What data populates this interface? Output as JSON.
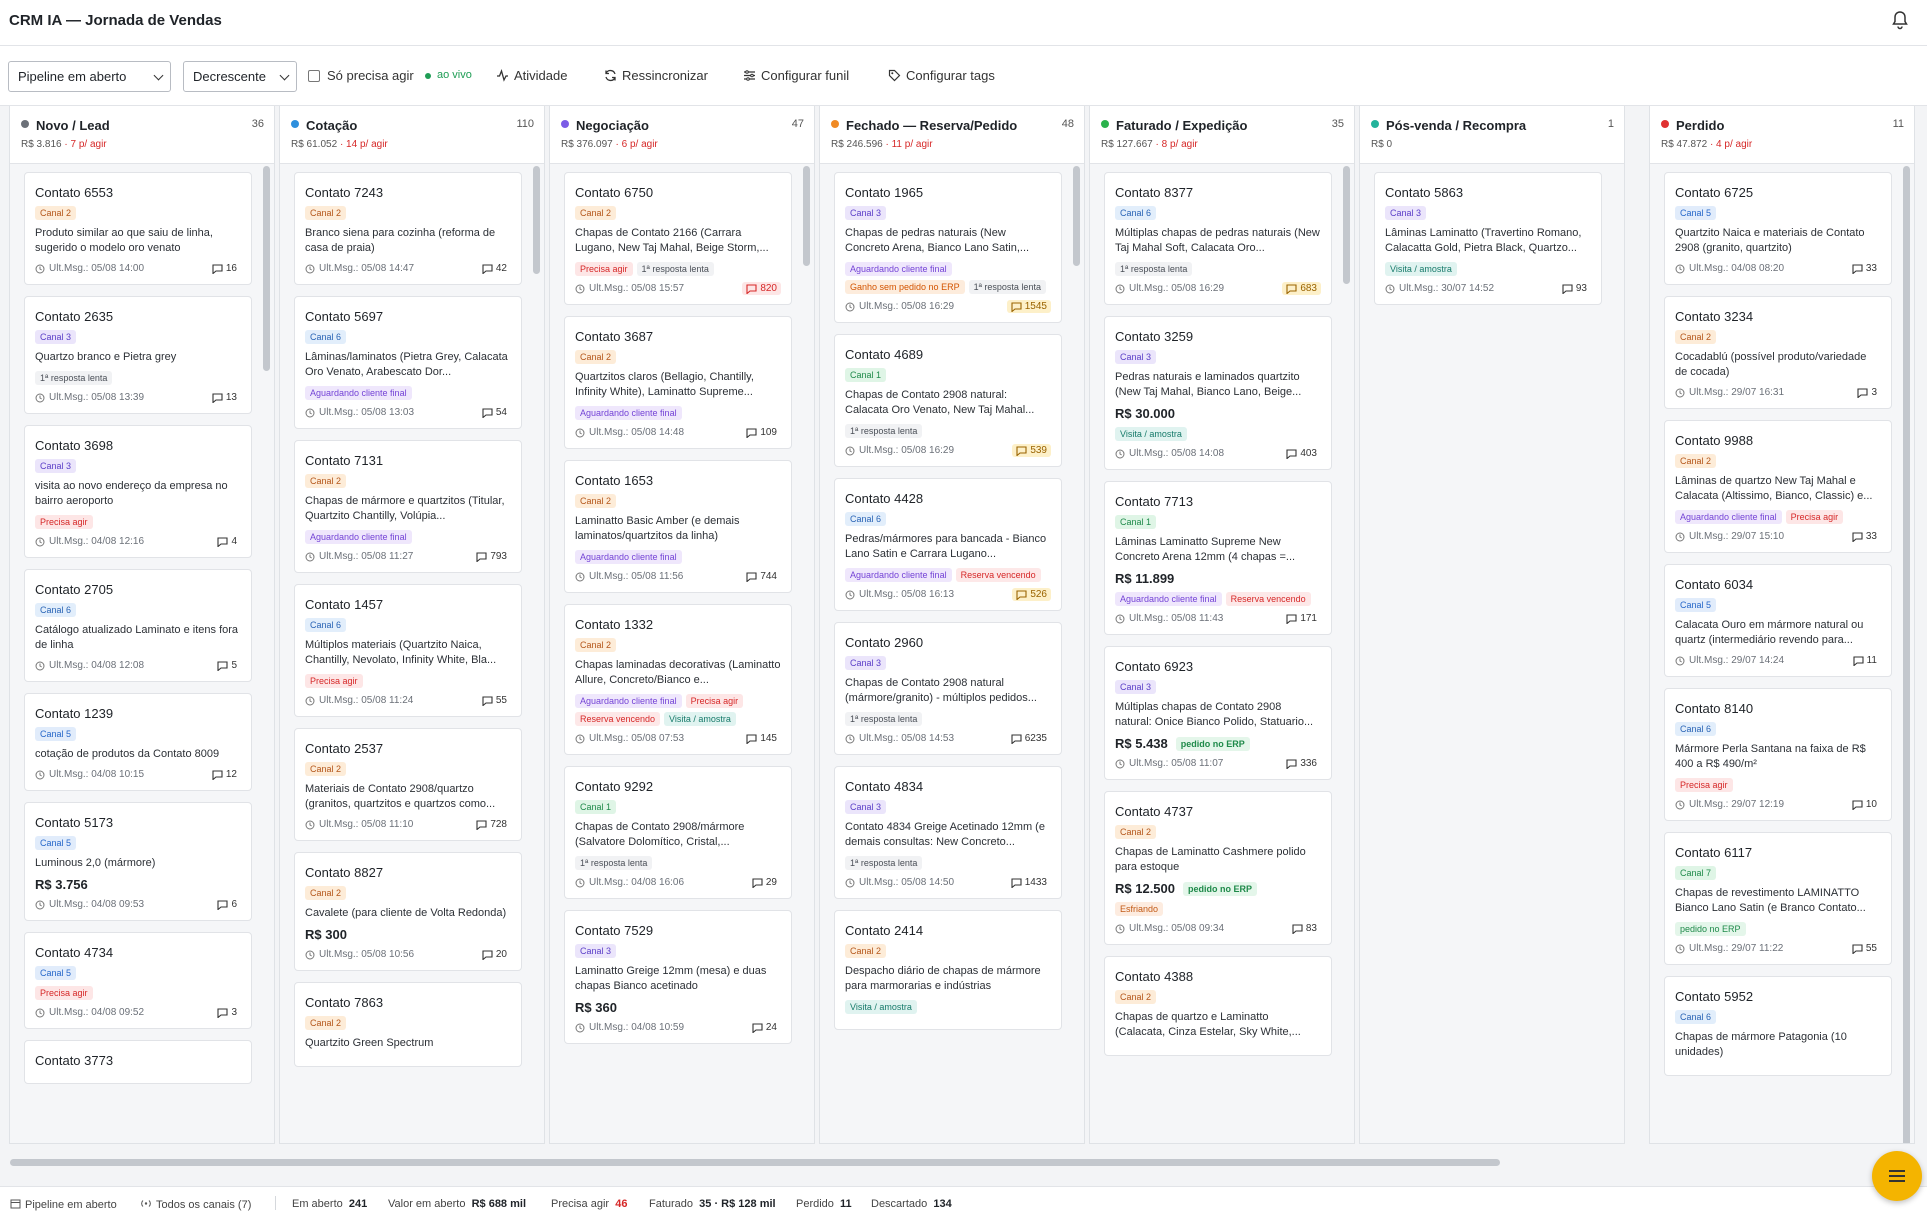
{
  "header": {
    "title": "CRM IA — Jornada de Vendas"
  },
  "toolbar": {
    "pipeline_select": "Pipeline em aberto",
    "order_select": "Decrescente",
    "only_action_label": "Só precisa agir",
    "live_label": "ao vivo",
    "activity_label": "Atividade",
    "resync_label": "Ressincronizar",
    "funnel_label": "Configurar funil",
    "tags_label": "Configurar tags"
  },
  "columns": [
    {
      "title": "Novo / Lead",
      "count": "36",
      "total": "R$ 3.816",
      "act": "· 7 p/ agir",
      "color": "#6b7078",
      "cards": [
        {
          "name": "Contato 6553",
          "tags": [
            [
              "Canal 2",
              "canal"
            ]
          ],
          "desc": "Produto similar ao que saiu de linha, sugerido o modelo oro venato",
          "time": "Ult.Msg.: 05/08 14:00",
          "msgs": "16"
        },
        {
          "name": "Contato 2635",
          "tags": [
            [
              "Canal 3",
              "c3"
            ]
          ],
          "desc": "Quartzo branco e Pietra grey",
          "tags2": [
            [
              "1ª resposta lenta",
              "lenta"
            ]
          ],
          "time": "Ult.Msg.: 05/08 13:39",
          "msgs": "13"
        },
        {
          "name": "Contato 3698",
          "tags": [
            [
              "Canal 3",
              "c3"
            ]
          ],
          "desc": "visita ao novo endereço da empresa no bairro aeroporto",
          "tags2": [
            [
              "Precisa agir",
              "agir"
            ]
          ],
          "time": "Ult.Msg.: 04/08 12:16",
          "msgs": "4"
        },
        {
          "name": "Contato 2705",
          "tags": [
            [
              "Canal 6",
              "c6"
            ]
          ],
          "desc": "Catálogo atualizado Laminato e itens fora de linha",
          "time": "Ult.Msg.: 04/08 12:08",
          "msgs": "5"
        },
        {
          "name": "Contato 1239",
          "tags": [
            [
              "Canal 5",
              "c5"
            ]
          ],
          "desc": "cotação de produtos da Contato 8009",
          "time": "Ult.Msg.: 04/08 10:15",
          "msgs": "12"
        },
        {
          "name": "Contato 5173",
          "tags": [
            [
              "Canal 5",
              "c5"
            ]
          ],
          "desc": "Luminous 2,0 (mármore)",
          "value": "R$ 3.756",
          "time": "Ult.Msg.: 04/08 09:53",
          "msgs": "6"
        },
        {
          "name": "Contato 4734",
          "tags": [
            [
              "Canal 5",
              "c5"
            ]
          ],
          "tags2": [
            [
              "Precisa agir",
              "agir"
            ]
          ],
          "time": "Ult.Msg.: 04/08 09:52",
          "msgs": "3"
        },
        {
          "name": "Contato 3773",
          "tags": [],
          "time": "",
          "msgs": ""
        }
      ]
    },
    {
      "title": "Cotação",
      "count": "110",
      "total": "R$ 61.052",
      "act": "· 14 p/ agir",
      "color": "#2d8fdd",
      "cards": [
        {
          "name": "Contato 7243",
          "tags": [
            [
              "Canal 2",
              "canal"
            ]
          ],
          "desc": "Branco siena para cozinha (reforma de casa de praia)",
          "time": "Ult.Msg.: 05/08 14:47",
          "msgs": "42"
        },
        {
          "name": "Contato 5697",
          "tags": [
            [
              "Canal 6",
              "c6"
            ]
          ],
          "desc": "Lâminas/laminatos (Pietra Grey, Calacata Oro Venato, Arabescato Dor...",
          "tags2": [
            [
              "Aguardando cliente final",
              "aguard"
            ]
          ],
          "time": "Ult.Msg.: 05/08 13:03",
          "msgs": "54"
        },
        {
          "name": "Contato 7131",
          "tags": [
            [
              "Canal 2",
              "canal"
            ]
          ],
          "desc": "Chapas de mármore e quartzitos (Titular, Quartzito Chantilly, Volúpia...",
          "tags2": [
            [
              "Aguardando cliente final",
              "aguard"
            ]
          ],
          "time": "Ult.Msg.: 05/08 11:27",
          "msgs": "793"
        },
        {
          "name": "Contato 1457",
          "tags": [
            [
              "Canal 6",
              "c6"
            ]
          ],
          "desc": "Múltiplos materiais (Quartzito Naica, Chantilly, Nevolato, Infinity White, Bla...",
          "tags2": [
            [
              "Precisa agir",
              "agir"
            ]
          ],
          "time": "Ult.Msg.: 05/08 11:24",
          "msgs": "55"
        },
        {
          "name": "Contato 2537",
          "tags": [
            [
              "Canal 2",
              "canal"
            ]
          ],
          "desc": "Materiais de Contato 2908/quartzo (granitos, quartzitos e quartzos como...",
          "time": "Ult.Msg.: 05/08 11:10",
          "msgs": "728"
        },
        {
          "name": "Contato 8827",
          "tags": [
            [
              "Canal 2",
              "canal"
            ]
          ],
          "desc": "Cavalete (para cliente de Volta Redonda)",
          "value": "R$ 300",
          "time": "Ult.Msg.: 05/08 10:56",
          "msgs": "20"
        },
        {
          "name": "Contato 7863",
          "tags": [
            [
              "Canal 2",
              "canal"
            ]
          ],
          "desc": "Quartzito Green Spectrum",
          "time": "",
          "msgs": ""
        }
      ]
    },
    {
      "title": "Negociação",
      "count": "47",
      "total": "R$ 376.097",
      "act": "· 6 p/ agir",
      "color": "#7b5ce6",
      "cards": [
        {
          "name": "Contato 6750",
          "tags": [
            [
              "Canal 2",
              "canal"
            ]
          ],
          "desc": "Chapas de Contato 2166 (Carrara Lugano, New Taj Mahal, Beige Storm,...",
          "tags2": [
            [
              "Precisa agir",
              "agir"
            ],
            [
              "1ª resposta lenta",
              "lenta"
            ]
          ],
          "time": "Ult.Msg.: 05/08 15:57",
          "msgs": "820",
          "hot": "hot"
        },
        {
          "name": "Contato 3687",
          "tags": [
            [
              "Canal 2",
              "canal"
            ]
          ],
          "desc": "Quartzitos claros (Bellagio, Chantilly, Infinity White), Laminatto Supreme...",
          "tags2": [
            [
              "Aguardando cliente final",
              "aguard"
            ]
          ],
          "time": "Ult.Msg.: 05/08 14:48",
          "msgs": "109"
        },
        {
          "name": "Contato 1653",
          "tags": [
            [
              "Canal 2",
              "canal"
            ]
          ],
          "desc": "Laminatto Basic Amber (e demais laminatos/quartzitos da linha)",
          "tags2": [
            [
              "Aguardando cliente final",
              "aguard"
            ]
          ],
          "time": "Ult.Msg.: 05/08 11:56",
          "msgs": "744"
        },
        {
          "name": "Contato 1332",
          "tags": [
            [
              "Canal 2",
              "canal"
            ]
          ],
          "desc": "Chapas laminadas decorativas (Laminatto Allure, Concreto/Bianco e...",
          "tags2": [
            [
              "Aguardando cliente final",
              "aguard"
            ],
            [
              "Precisa agir",
              "agir"
            ],
            [
              "Reserva vencendo",
              "reserva"
            ],
            [
              "Visita / amostra",
              "visita"
            ]
          ],
          "time": "Ult.Msg.: 05/08 07:53",
          "msgs": "145"
        },
        {
          "name": "Contato 9292",
          "tags": [
            [
              "Canal 1",
              "c1"
            ]
          ],
          "desc": "Chapas de Contato 2908/mármore (Salvatore Dolomítico, Cristal,...",
          "tags2": [
            [
              "1ª resposta lenta",
              "lenta"
            ]
          ],
          "time": "Ult.Msg.: 04/08 16:06",
          "msgs": "29"
        },
        {
          "name": "Contato 7529",
          "tags": [
            [
              "Canal 3",
              "c3"
            ]
          ],
          "desc": "Laminatto Greige 12mm (mesa) e duas chapas Bianco acetinado",
          "value": "R$ 360",
          "time": "Ult.Msg.: 04/08 10:59",
          "msgs": "24"
        }
      ]
    },
    {
      "title": "Fechado — Reserva/Pedido",
      "count": "48",
      "total": "R$ 246.596",
      "act": "· 11 p/ agir",
      "color": "#f08a24",
      "cards": [
        {
          "name": "Contato 1965",
          "tags": [
            [
              "Canal 3",
              "c3"
            ]
          ],
          "desc": "Chapas de pedras naturais (New Concreto Arena, Bianco Lano Satin,...",
          "tags2": [
            [
              "Aguardando cliente final",
              "aguard"
            ],
            [
              "Ganho sem pedido no ERP",
              "ganho"
            ],
            [
              "1ª resposta lenta",
              "lenta"
            ]
          ],
          "time": "Ult.Msg.: 05/08 16:29",
          "msgs": "1545",
          "hot": "warm"
        },
        {
          "name": "Contato 4689",
          "tags": [
            [
              "Canal 1",
              "c1"
            ]
          ],
          "desc": "Chapas de Contato 2908 natural: Calacata Oro Venato, New Taj Mahal...",
          "tags2": [
            [
              "1ª resposta lenta",
              "lenta"
            ]
          ],
          "time": "Ult.Msg.: 05/08 16:29",
          "msgs": "539",
          "hot": "warm"
        },
        {
          "name": "Contato 4428",
          "tags": [
            [
              "Canal 6",
              "c6"
            ]
          ],
          "desc": "Pedras/mármores para bancada - Bianco Lano Satin e Carrara Lugano...",
          "tags2": [
            [
              "Aguardando cliente final",
              "aguard"
            ],
            [
              "Reserva vencendo",
              "reserva"
            ]
          ],
          "time": "Ult.Msg.: 05/08 16:13",
          "msgs": "526",
          "hot": "warm"
        },
        {
          "name": "Contato 2960",
          "tags": [
            [
              "Canal 3",
              "c3"
            ]
          ],
          "desc": "Chapas de Contato 2908 natural (mármore/granito) - múltiplos pedidos...",
          "tags2": [
            [
              "1ª resposta lenta",
              "lenta"
            ]
          ],
          "time": "Ult.Msg.: 05/08 14:53",
          "msgs": "6235"
        },
        {
          "name": "Contato 4834",
          "tags": [
            [
              "Canal 3",
              "c3"
            ]
          ],
          "desc": "Contato 4834 Greige Acetinado 12mm (e demais consultas: New Concreto...",
          "tags2": [
            [
              "1ª resposta lenta",
              "lenta"
            ]
          ],
          "time": "Ult.Msg.: 05/08 14:50",
          "msgs": "1433"
        },
        {
          "name": "Contato 2414",
          "tags": [
            [
              "Canal 2",
              "canal"
            ]
          ],
          "desc": "Despacho diário de chapas de mármore para marmorarias e indústrias",
          "tags2": [
            [
              "Visita / amostra",
              "visita"
            ]
          ],
          "time": "",
          "msgs": ""
        }
      ]
    },
    {
      "title": "Faturado / Expedição",
      "count": "35",
      "total": "R$ 127.667",
      "act": "· 8 p/ agir",
      "color": "#2bb24c",
      "cards": [
        {
          "name": "Contato 8377",
          "tags": [
            [
              "Canal 6",
              "c6"
            ]
          ],
          "desc": "Múltiplas chapas de pedras naturais (New Taj Mahal Soft, Calacata Oro...",
          "tags2": [
            [
              "1ª resposta lenta",
              "lenta"
            ]
          ],
          "time": "Ult.Msg.: 05/08 16:29",
          "msgs": "683",
          "hot": "warm"
        },
        {
          "name": "Contato 3259",
          "tags": [
            [
              "Canal 3",
              "c3"
            ]
          ],
          "desc": "Pedras naturais e laminados quartzito (New Taj Mahal, Bianco Lano, Beige...",
          "value": "R$ 30.000",
          "tags2": [
            [
              "Visita / amostra",
              "visita"
            ]
          ],
          "time": "Ult.Msg.: 05/08 14:08",
          "msgs": "403"
        },
        {
          "name": "Contato 7713",
          "tags": [
            [
              "Canal 1",
              "c1"
            ]
          ],
          "desc": "Lâminas Laminatto Supreme New Concreto Arena 12mm (4 chapas =...",
          "value": "R$ 11.899",
          "tags2": [
            [
              "Aguardando cliente final",
              "aguard"
            ],
            [
              "Reserva vencendo",
              "reserva"
            ]
          ],
          "time": "Ult.Msg.: 05/08 11:43",
          "msgs": "171"
        },
        {
          "name": "Contato 6923",
          "tags": [
            [
              "Canal 3",
              "c3"
            ]
          ],
          "desc": "Múltiplas chapas de Contato 2908 natural: Onice Bianco Polido, Statuario...",
          "value": "R$ 5.438",
          "erp": "pedido no ERP",
          "time": "Ult.Msg.: 05/08 11:07",
          "msgs": "336"
        },
        {
          "name": "Contato 4737",
          "tags": [
            [
              "Canal 2",
              "canal"
            ]
          ],
          "desc": "Chapas de Laminatto Cashmere polido para estoque",
          "value": "R$ 12.500",
          "erp": "pedido no ERP",
          "tags2": [
            [
              "Esfriando",
              "esfr"
            ]
          ],
          "time": "Ult.Msg.: 05/08 09:34",
          "msgs": "83"
        },
        {
          "name": "Contato 4388",
          "tags": [
            [
              "Canal 2",
              "canal"
            ]
          ],
          "desc": "Chapas de quartzo e Laminatto (Calacata, Cinza Estelar, Sky White,...",
          "time": "",
          "msgs": ""
        }
      ]
    },
    {
      "title": "Pós-venda / Recompra",
      "count": "1",
      "total": "R$ 0",
      "act": "",
      "color": "#23b39b",
      "cards": [
        {
          "name": "Contato 5863",
          "tags": [
            [
              "Canal 3",
              "c3"
            ]
          ],
          "desc": "Lâminas Laminatto (Travertino Romano, Calacatta Gold, Pietra Black, Quartzo...",
          "tags2": [
            [
              "Visita / amostra",
              "visita"
            ]
          ],
          "time": "Ult.Msg.: 30/07 14:52",
          "msgs": "93"
        }
      ]
    },
    {
      "title": "Perdido",
      "count": "11",
      "total": "R$ 47.872",
      "act": "· 4 p/ agir",
      "color": "#e03131",
      "cards": [
        {
          "name": "Contato 6725",
          "tags": [
            [
              "Canal 5",
              "c5"
            ]
          ],
          "desc": "Quartzito Naica e materiais de Contato 2908 (granito, quartzito)",
          "time": "Ult.Msg.: 04/08 08:20",
          "msgs": "33"
        },
        {
          "name": "Contato 3234",
          "tags": [
            [
              "Canal 2",
              "canal"
            ]
          ],
          "desc": "Cocadablú (possível produto/variedade de cocada)",
          "time": "Ult.Msg.: 29/07 16:31",
          "msgs": "3"
        },
        {
          "name": "Contato 9988",
          "tags": [
            [
              "Canal 2",
              "canal"
            ]
          ],
          "desc": "Lâminas de quartzo New Taj Mahal e Calacata (Altissimo, Bianco, Classic) e...",
          "tags2": [
            [
              "Aguardando cliente final",
              "aguard"
            ],
            [
              "Precisa agir",
              "agir"
            ]
          ],
          "time": "Ult.Msg.: 29/07 15:10",
          "msgs": "33"
        },
        {
          "name": "Contato 6034",
          "tags": [
            [
              "Canal 5",
              "c5"
            ]
          ],
          "desc": "Calacata Ouro em mármore natural ou quartz (intermediário revendo para...",
          "time": "Ult.Msg.: 29/07 14:24",
          "msgs": "11"
        },
        {
          "name": "Contato 8140",
          "tags": [
            [
              "Canal 6",
              "c6"
            ]
          ],
          "desc": "Mármore Perla Santana na faixa de R$ 400 a R$ 490/m²",
          "tags2": [
            [
              "Precisa agir",
              "agir"
            ]
          ],
          "time": "Ult.Msg.: 29/07 12:19",
          "msgs": "10"
        },
        {
          "name": "Contato 6117",
          "tags": [
            [
              "Canal 7",
              "c7"
            ]
          ],
          "desc": "Chapas de revestimento LAMINATTO Bianco Lano Satin (e Branco Contato...",
          "tags2": [
            [
              "pedido no ERP",
              "erp"
            ]
          ],
          "time": "Ult.Msg.: 29/07 11:22",
          "msgs": "55"
        },
        {
          "name": "Contato 5952",
          "tags": [
            [
              "Canal 6",
              "c6"
            ]
          ],
          "desc": "Chapas de mármore Patagonia (10 unidades)",
          "time": "",
          "msgs": ""
        }
      ]
    }
  ],
  "status": {
    "pipeline": "Pipeline em aberto",
    "channels": "Todos os canais (7)",
    "open_label": "Em aberto",
    "open_value": "241",
    "value_label": "Valor em aberto",
    "value_value": "R$ 688 mil",
    "action_label": "Precisa agir",
    "action_value": "46",
    "billed_label": "Faturado",
    "billed_value": "35 · R$ 128 mil",
    "lost_label": "Perdido",
    "lost_value": "11",
    "discard_label": "Descartado",
    "discard_value": "134"
  }
}
